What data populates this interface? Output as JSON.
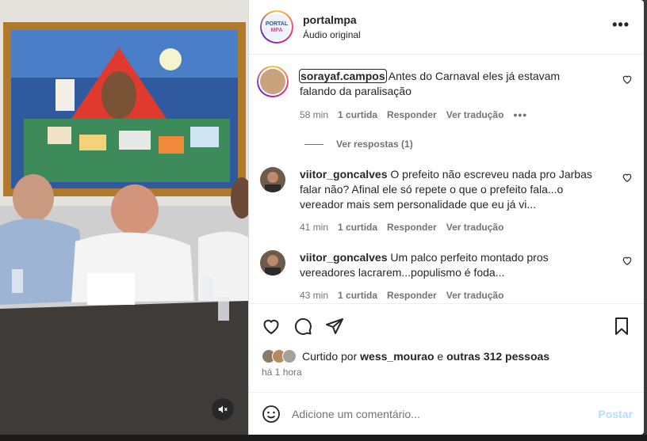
{
  "header": {
    "username": "portalmpa",
    "subtitle": "Áudio original",
    "logo_text_top": "PORTAL",
    "logo_text_bottom": "MPA",
    "more_label": "•••"
  },
  "comments": [
    {
      "username": "sorayaf.campos",
      "text": "Antes do Carnaval eles já estavam falando da paralisação",
      "time": "58 min",
      "likes": "1 curtida",
      "reply": "Responder",
      "translate": "Ver tradução",
      "more": "•••",
      "view_replies": "Ver respostas (1)"
    },
    {
      "username": "viitor_goncalves",
      "text": "O prefeito não escreveu nada pro Jarbas falar não? Afinal ele só repete o que o prefeito fala...o vereador mais sem personalidade que eu já vi...",
      "time": "41 min",
      "likes": "1 curtida",
      "reply": "Responder",
      "translate": "Ver tradução"
    },
    {
      "username": "viitor_goncalves",
      "text": "Um palco perfeito montado pros vereadores lacrarem...populismo é foda...",
      "time": "43 min",
      "likes": "1 curtida",
      "reply": "Responder",
      "translate": "Ver tradução"
    }
  ],
  "likes_line": {
    "prefix": "Curtido por",
    "user": "wess_mourao",
    "joiner": "e",
    "others": "outras 312 pessoas"
  },
  "posted_time": "há 1 hora",
  "add_comment": {
    "placeholder": "Adicione um comentário...",
    "post_label": "Postar"
  },
  "colors": {
    "text": "#262626",
    "muted": "#737373",
    "post_disabled": "#b2dffc",
    "border": "#efefef"
  }
}
